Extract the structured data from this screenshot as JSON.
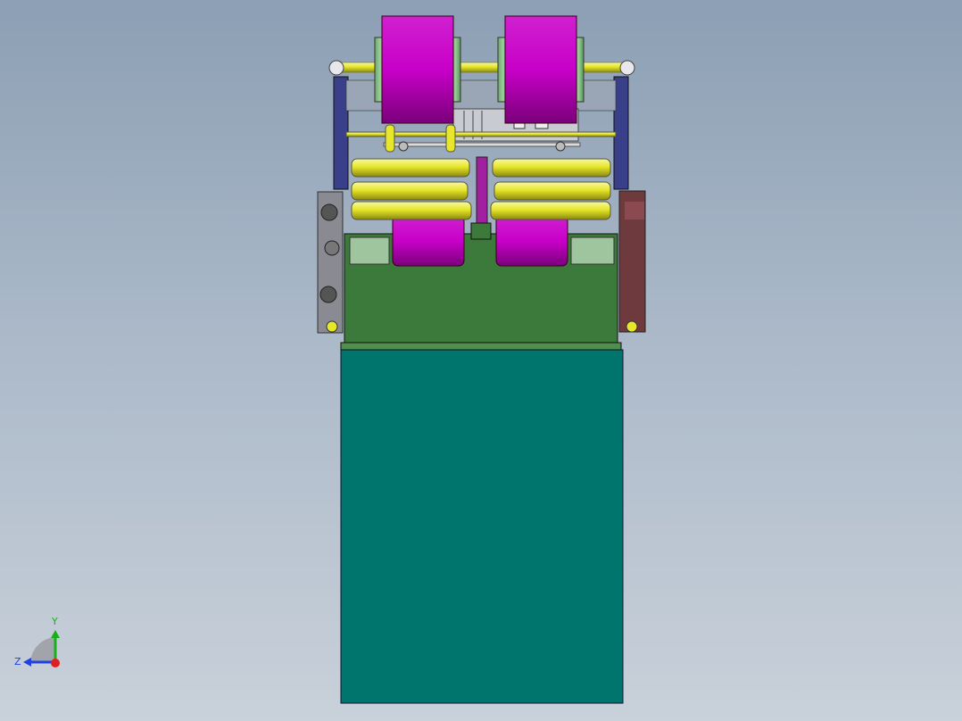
{
  "viewport": {
    "background_top": "#8c9fb4",
    "background_bottom": "#c9d1da"
  },
  "model_colors": {
    "magenta_roll": "#c800c8",
    "yellow_shaft": "#e6e62a",
    "green_plate": "#3c7a3c",
    "teal_base": "#00756e",
    "frame_blue": "#3a3f8a",
    "maroon_housing": "#6e3a3e"
  },
  "triad": {
    "y_label": "Y",
    "z_label": "Z",
    "x_color": "#e02020",
    "y_color": "#18b018",
    "z_color": "#2040e0"
  }
}
